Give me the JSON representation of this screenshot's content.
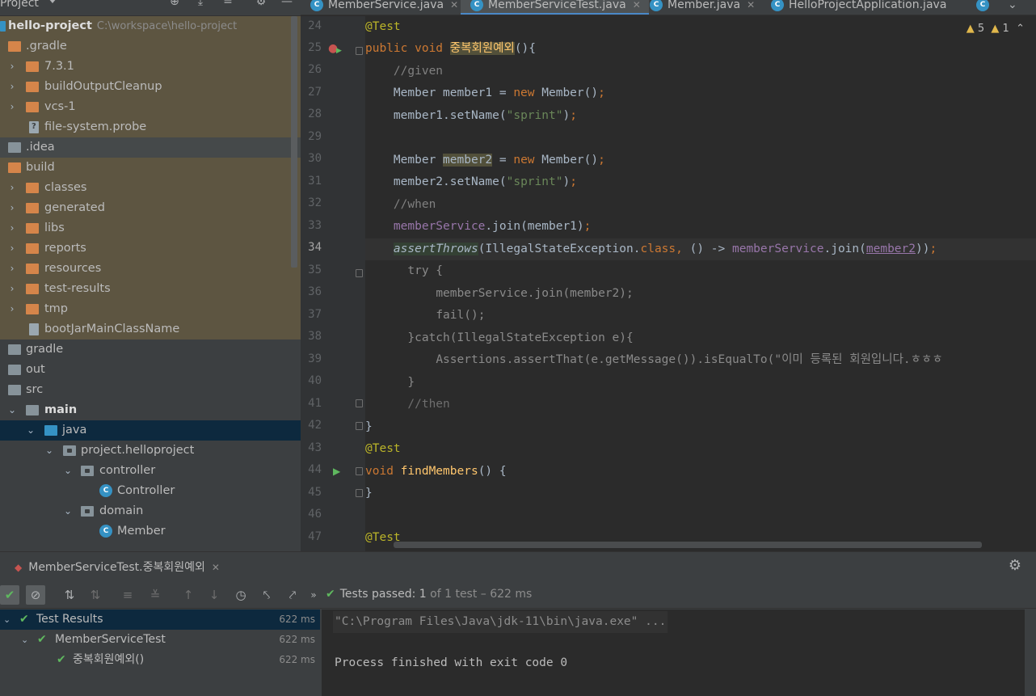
{
  "project": {
    "header_title": "Project",
    "tree": [
      {
        "label": "hello-project",
        "path": "C:\\workspace\\hello-project"
      },
      {
        "label": ".gradle"
      },
      {
        "label": "7.3.1"
      },
      {
        "label": "buildOutputCleanup"
      },
      {
        "label": "vcs-1"
      },
      {
        "label": "file-system.probe"
      },
      {
        "label": ".idea"
      },
      {
        "label": "build"
      },
      {
        "label": "classes"
      },
      {
        "label": "generated"
      },
      {
        "label": "libs"
      },
      {
        "label": "reports"
      },
      {
        "label": "resources"
      },
      {
        "label": "test-results"
      },
      {
        "label": "tmp"
      },
      {
        "label": "bootJarMainClassName"
      },
      {
        "label": "gradle"
      },
      {
        "label": "out"
      },
      {
        "label": "src"
      },
      {
        "label": "main"
      },
      {
        "label": "java"
      },
      {
        "label": "project.helloproject"
      },
      {
        "label": "controller"
      },
      {
        "label": "Controller"
      },
      {
        "label": "domain"
      },
      {
        "label": "Member"
      }
    ]
  },
  "editor": {
    "tabs": [
      {
        "label": "MemberService.java"
      },
      {
        "label": "MemberServiceTest.java"
      },
      {
        "label": "Member.java"
      },
      {
        "label": "HelloProjectApplication.java"
      }
    ],
    "inspection": {
      "warnings": "5",
      "weak_warnings": "1"
    },
    "line_numbers": [
      "24",
      "25",
      "26",
      "27",
      "28",
      "29",
      "30",
      "31",
      "32",
      "33",
      "34",
      "35",
      "36",
      "37",
      "38",
      "39",
      "40",
      "41",
      "42",
      "43",
      "44",
      "45",
      "46",
      "47"
    ],
    "current_line": "34",
    "code": {
      "l24": "@Test",
      "l25_kw": "public void ",
      "l25_fn": "중복회원예외",
      "l25_rest": "(){",
      "l26": "//given",
      "l27_a": "Member member1 = ",
      "l27_kw": "new",
      "l27_b": " Member()",
      "l27_semi": ";",
      "l28_a": "member1.setName(",
      "l28_st": "\"sprint\"",
      "l28_b": ")",
      "l28_semi": ";",
      "l30_a": "Member ",
      "l30_var": "member2",
      "l30_b": " = ",
      "l30_kw": "new",
      "l30_c": " Member()",
      "l30_semi": ";",
      "l31_a": "member2.setName(",
      "l31_st": "\"sprint\"",
      "l31_b": ")",
      "l31_semi": ";",
      "l32": "//when",
      "l33_fld": "memberService",
      "l33_a": ".join(member1)",
      "l33_semi": ";",
      "l34_fn": "assertThrows",
      "l34_a": "(IllegalStateException.",
      "l34_kw": "class",
      "l34_comma": ",",
      "l34_b": " () -> ",
      "l34_fld": "memberService",
      "l34_c": ".join(",
      "l34_var": "member2",
      "l34_d": "))",
      "l34_semi": ";",
      "l35": "try {",
      "l36": "memberService.join(member2);",
      "l37": "fail();",
      "l38": "}catch(IllegalStateException e){",
      "l39": "Assertions.assertThat(e.getMessage()).isEqualTo(\"이미 등록된 회원입니다.ㅎㅎㅎ",
      "l40": "}",
      "l41": "//then",
      "l42": "}",
      "l43": "@Test",
      "l44_kw": "void ",
      "l44_fn": "findMembers",
      "l44_rest": "() {",
      "l45": "}",
      "l47": "@Test"
    }
  },
  "run": {
    "tab_label": "MemberServiceTest.중복회원예외",
    "status": {
      "prefix": "Tests passed: ",
      "count": "1",
      "suffix": " of 1 test – 622 ms"
    },
    "results": [
      {
        "label": "Test Results",
        "time": "622 ms"
      },
      {
        "label": "MemberServiceTest",
        "time": "622 ms"
      },
      {
        "label": "중복회원예외()",
        "time": "622 ms"
      }
    ],
    "console": {
      "command": "\"C:\\Program Files\\Java\\jdk-11\\bin\\java.exe\" ...",
      "exit": "Process finished with exit code 0"
    }
  },
  "colors": {
    "accent": "#4a88c7",
    "pass_green": "#5fb85f",
    "keyword": "#cc7832",
    "string": "#6a8759",
    "annotation": "#bbb529"
  },
  "icons": {
    "project_header": [
      "globe-icon",
      "collapse-all-icon",
      "expand-icon",
      "gear-icon",
      "minimize-icon"
    ],
    "run_toolbar": [
      "check-icon",
      "cancel-icon",
      "sort-icon",
      "sort-duration-icon",
      "expand-all-icon",
      "collapse-all-icon",
      "up-icon",
      "down-icon",
      "history-icon",
      "import-icon",
      "export-icon",
      "more-icon"
    ]
  }
}
